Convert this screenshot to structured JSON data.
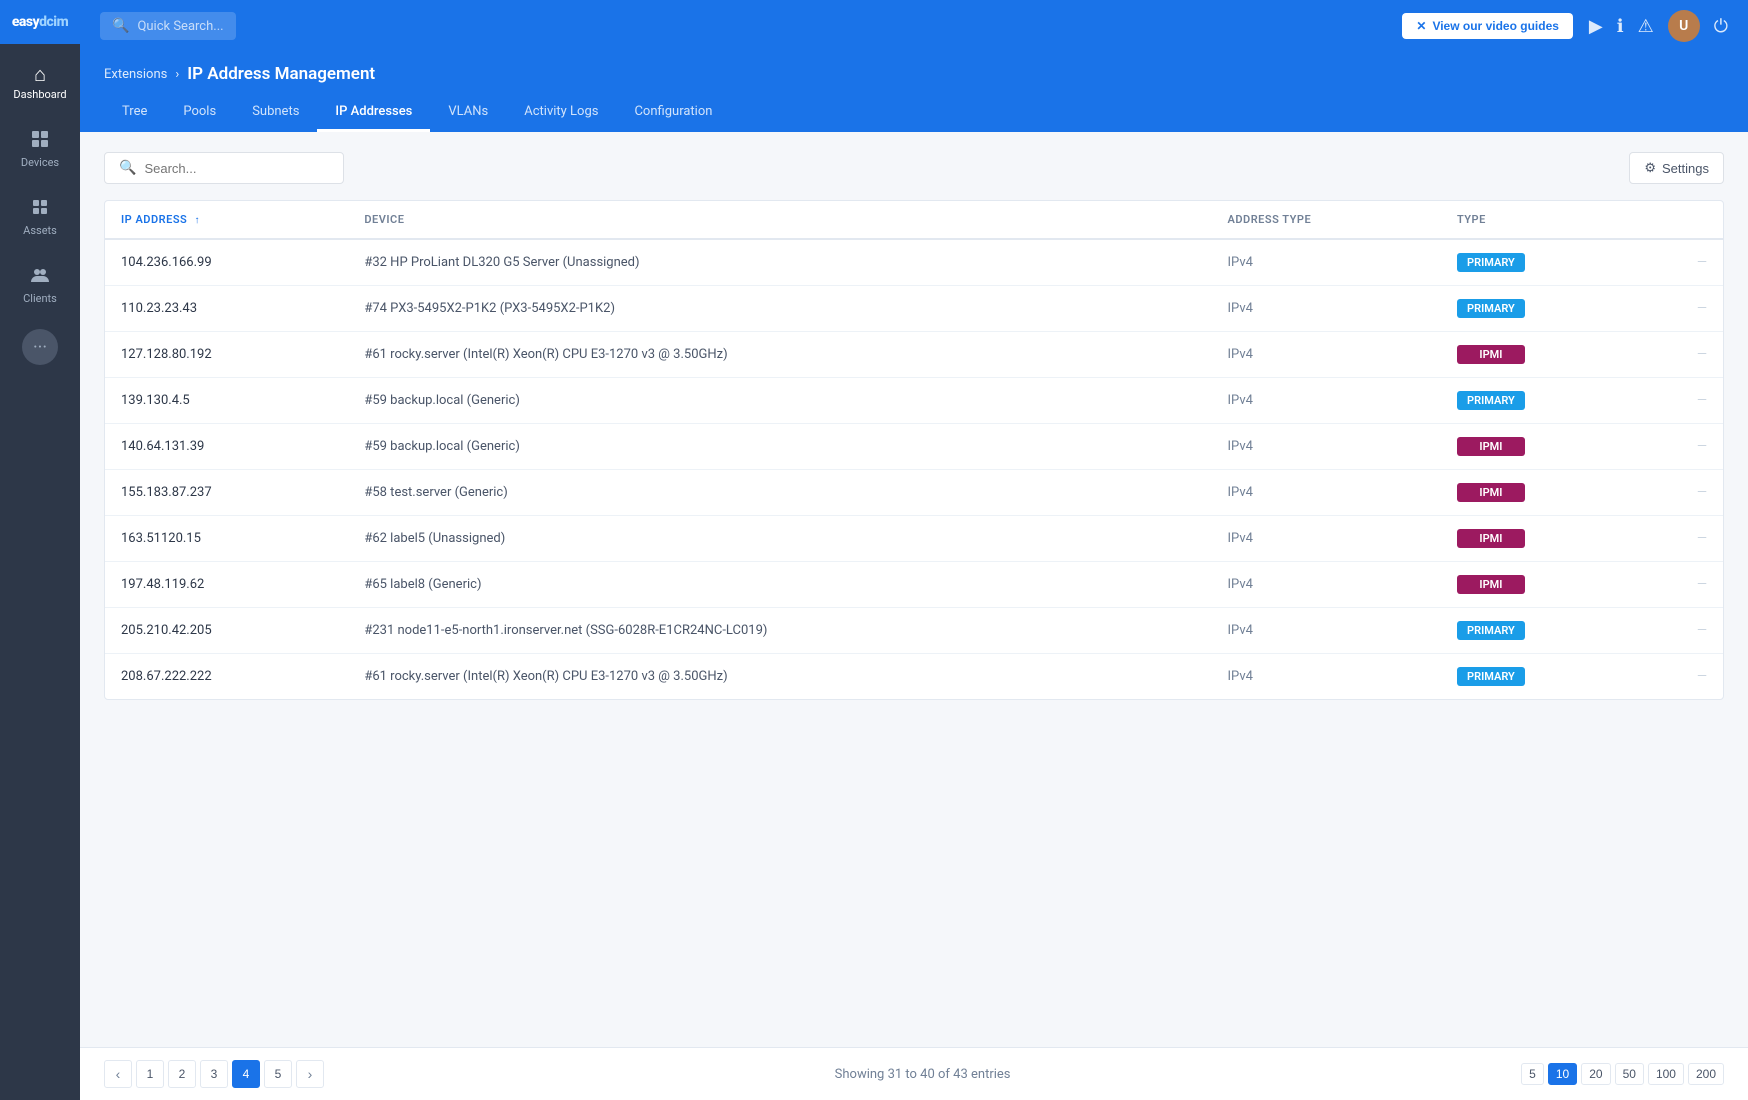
{
  "sidebar": {
    "logo": {
      "easy": "easy",
      "dcim": "dcim"
    },
    "items": [
      {
        "id": "dashboard",
        "label": "Dashboard",
        "icon": "⌂"
      },
      {
        "id": "devices",
        "label": "Devices",
        "icon": "⊞"
      },
      {
        "id": "assets",
        "label": "Assets",
        "icon": "⊡"
      },
      {
        "id": "clients",
        "label": "Clients",
        "icon": "👥"
      }
    ]
  },
  "topbar": {
    "search_placeholder": "Quick Search...",
    "video_btn_label": "View our video guides",
    "video_btn_close": "✕"
  },
  "header": {
    "breadcrumb_parent": "Extensions",
    "breadcrumb_separator": "›",
    "title": "IP Address Management",
    "tabs": [
      {
        "id": "tree",
        "label": "Tree",
        "active": false
      },
      {
        "id": "pools",
        "label": "Pools",
        "active": false
      },
      {
        "id": "subnets",
        "label": "Subnets",
        "active": false
      },
      {
        "id": "ip-addresses",
        "label": "IP Addresses",
        "active": true
      },
      {
        "id": "vlans",
        "label": "VLANs",
        "active": false
      },
      {
        "id": "activity-logs",
        "label": "Activity Logs",
        "active": false
      },
      {
        "id": "configuration",
        "label": "Configuration",
        "active": false
      }
    ]
  },
  "toolbar": {
    "search_placeholder": "Search...",
    "settings_label": "Settings"
  },
  "table": {
    "columns": [
      {
        "id": "ip-address",
        "label": "IP ADDRESS",
        "sortable": true
      },
      {
        "id": "device",
        "label": "DEVICE",
        "sortable": false
      },
      {
        "id": "address-type",
        "label": "ADDRESS TYPE",
        "sortable": false
      },
      {
        "id": "type",
        "label": "TYPE",
        "sortable": false
      },
      {
        "id": "actions",
        "label": "",
        "sortable": false
      }
    ],
    "rows": [
      {
        "ip": "104.236.166.99",
        "device": "#32 HP ProLiant DL320 G5 Server (Unassigned)",
        "address_type": "IPv4",
        "type": "PRIMARY",
        "type_style": "primary"
      },
      {
        "ip": "110.23.23.43",
        "device": "#74 PX3-5495X2-P1K2 (PX3-5495X2-P1K2)",
        "address_type": "IPv4",
        "type": "PRIMARY",
        "type_style": "primary"
      },
      {
        "ip": "127.128.80.192",
        "device": "#61 rocky.server (Intel(R) Xeon(R) CPU E3-1270 v3 @ 3.50GHz)",
        "address_type": "IPv4",
        "type": "IPMI",
        "type_style": "ipmi"
      },
      {
        "ip": "139.130.4.5",
        "device": "#59 backup.local (Generic)",
        "address_type": "IPv4",
        "type": "PRIMARY",
        "type_style": "primary"
      },
      {
        "ip": "140.64.131.39",
        "device": "#59 backup.local (Generic)",
        "address_type": "IPv4",
        "type": "IPMI",
        "type_style": "ipmi"
      },
      {
        "ip": "155.183.87.237",
        "device": "#58 test.server (Generic)",
        "address_type": "IPv4",
        "type": "IPMI",
        "type_style": "ipmi"
      },
      {
        "ip": "163.51120.15",
        "device": "#62 label5 (Unassigned)",
        "address_type": "IPv4",
        "type": "IPMI",
        "type_style": "ipmi"
      },
      {
        "ip": "197.48.119.62",
        "device": "#65 label8 (Generic)",
        "address_type": "IPv4",
        "type": "IPMI",
        "type_style": "ipmi"
      },
      {
        "ip": "205.210.42.205",
        "device": "#231 node11-e5-north1.ironserver.net (SSG-6028R-E1CR24NC-LC019)",
        "address_type": "IPv4",
        "type": "PRIMARY",
        "type_style": "primary"
      },
      {
        "ip": "208.67.222.222",
        "device": "#61 rocky.server (Intel(R) Xeon(R) CPU E3-1270 v3 @ 3.50GHz)",
        "address_type": "IPv4",
        "type": "PRIMARY",
        "type_style": "primary"
      }
    ]
  },
  "footer": {
    "showing_text": "Showing 31 to 40 of 43 entries",
    "pages": [
      1,
      2,
      3,
      4,
      5
    ],
    "active_page": 4,
    "page_sizes": [
      5,
      10,
      20,
      50,
      100,
      200
    ],
    "active_page_size": 10
  }
}
